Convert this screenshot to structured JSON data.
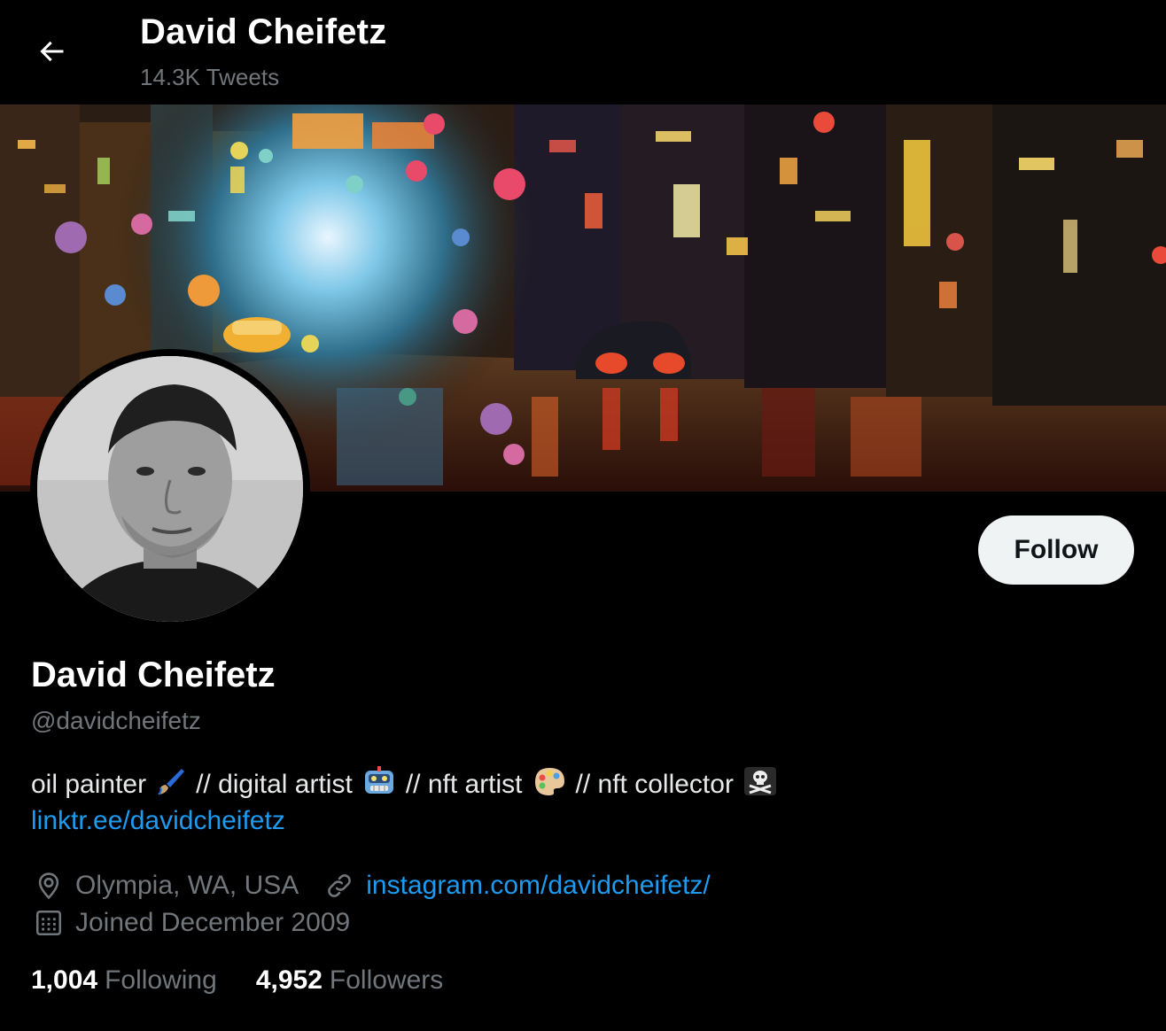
{
  "header": {
    "title": "David Cheifetz",
    "tweet_count": "14.3K Tweets"
  },
  "profile": {
    "name": "David Cheifetz",
    "handle": "@davidcheifetz",
    "follow_label": "Follow",
    "bio": {
      "part1": "oil painter",
      "part2": "// digital artist",
      "part3": "// nft artist",
      "part4": "// nft collector",
      "emoji1": "paintbrush-icon",
      "emoji2": "robot-icon",
      "emoji3": "palette-icon",
      "emoji4": "skull-crossbones-icon"
    },
    "bio_link": "linktr.ee/davidcheifetz",
    "location": "Olympia, WA, USA",
    "website": "instagram.com/davidcheifetz/",
    "joined": "Joined December 2009",
    "following_count": "1,004",
    "following_label": "Following",
    "followers_count": "4,952",
    "followers_label": "Followers"
  },
  "colors": {
    "background": "#000000",
    "link": "#1d9bf0",
    "secondary_text": "#71767b",
    "follow_button_bg": "#eff3f4"
  }
}
